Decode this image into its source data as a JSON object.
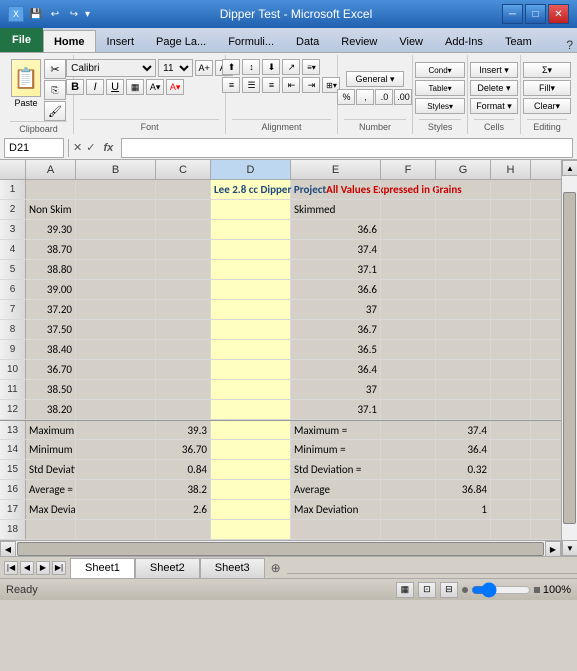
{
  "window": {
    "title": "Dipper Test - Microsoft Excel"
  },
  "tabs": [
    "File",
    "Home",
    "Insert",
    "Page Layout",
    "Formulas",
    "Data",
    "Review",
    "View",
    "Add-Ins",
    "Team"
  ],
  "nameBox": "D21",
  "ribbon": {
    "clipboard": "Clipboard",
    "font": "Font",
    "alignment": "Alignment",
    "number": "Number",
    "styles": "Styles",
    "cells": "Cells",
    "editing": "Editing"
  },
  "fontName": "Calibri",
  "fontSize": "11",
  "columns": [
    "A",
    "B",
    "C",
    "D",
    "E",
    "F",
    "G",
    "H"
  ],
  "rows": [
    {
      "num": 1,
      "cells": {
        "A": "",
        "B": "",
        "C": "",
        "D": "Lee 2.8 cc Dipper Project All Values Expressed in Grains",
        "E": "",
        "F": "",
        "G": "",
        "H": ""
      },
      "merged": true,
      "titleBlue": "Lee 2.8 cc Dipper Project ",
      "titleRed": "All Values Expressed in Grains"
    },
    {
      "num": 2,
      "cells": {
        "A": "Non Skim",
        "B": "",
        "C": "",
        "D": "",
        "E": "Skimmed",
        "F": "",
        "G": "",
        "H": ""
      }
    },
    {
      "num": 3,
      "cells": {
        "A": "39.30",
        "B": "",
        "C": "",
        "D": "",
        "E": "36.6",
        "F": "",
        "G": "",
        "H": ""
      }
    },
    {
      "num": 4,
      "cells": {
        "A": "38.70",
        "B": "",
        "C": "",
        "D": "",
        "E": "37.4",
        "F": "",
        "G": "",
        "H": ""
      }
    },
    {
      "num": 5,
      "cells": {
        "A": "38.80",
        "B": "",
        "C": "",
        "D": "",
        "E": "37.1",
        "F": "",
        "G": "",
        "H": ""
      }
    },
    {
      "num": 6,
      "cells": {
        "A": "39.00",
        "B": "",
        "C": "",
        "D": "",
        "E": "36.6",
        "F": "",
        "G": "",
        "H": ""
      }
    },
    {
      "num": 7,
      "cells": {
        "A": "37.20",
        "B": "",
        "C": "",
        "D": "",
        "E": "37",
        "F": "",
        "G": "",
        "H": ""
      }
    },
    {
      "num": 8,
      "cells": {
        "A": "37.50",
        "B": "",
        "C": "",
        "D": "",
        "E": "36.7",
        "F": "",
        "G": "",
        "H": ""
      }
    },
    {
      "num": 9,
      "cells": {
        "A": "38.40",
        "B": "",
        "C": "",
        "D": "",
        "E": "36.5",
        "F": "",
        "G": "",
        "H": ""
      }
    },
    {
      "num": 10,
      "cells": {
        "A": "36.70",
        "B": "",
        "C": "",
        "D": "",
        "E": "36.4",
        "F": "",
        "G": "",
        "H": ""
      }
    },
    {
      "num": 11,
      "cells": {
        "A": "38.50",
        "B": "",
        "C": "",
        "D": "",
        "E": "37",
        "F": "",
        "G": "",
        "H": ""
      }
    },
    {
      "num": 12,
      "cells": {
        "A": "38.20",
        "B": "",
        "C": "",
        "D": "",
        "E": "37.1",
        "F": "",
        "G": "",
        "H": ""
      }
    },
    {
      "num": 13,
      "cells": {
        "A": "Maximum =",
        "B": "",
        "C": "39.3",
        "D": "",
        "E": "Maximum =",
        "F": "",
        "G": "37.4",
        "H": ""
      }
    },
    {
      "num": 14,
      "cells": {
        "A": "Minimum =",
        "B": "",
        "C": "36.70",
        "D": "",
        "E": "Minimum =",
        "F": "",
        "G": "36.4",
        "H": ""
      }
    },
    {
      "num": 15,
      "cells": {
        "A": "Std Deviation  =",
        "B": "",
        "C": "0.84",
        "D": "",
        "E": "Std Deviation =",
        "F": "",
        "G": "0.32",
        "H": ""
      }
    },
    {
      "num": 16,
      "cells": {
        "A": "Average =",
        "B": "",
        "C": "38.2",
        "D": "",
        "E": "Average",
        "F": "",
        "G": "36.84",
        "H": ""
      }
    },
    {
      "num": 17,
      "cells": {
        "A": "Max Deviation =",
        "B": "",
        "C": "2.6",
        "D": "",
        "E": "Max Deviation",
        "F": "",
        "G": "1",
        "H": ""
      }
    },
    {
      "num": 18,
      "cells": {
        "A": "",
        "B": "",
        "C": "",
        "D": "",
        "E": "",
        "F": "",
        "G": "",
        "H": ""
      }
    }
  ],
  "sheets": [
    "Sheet1",
    "Sheet2",
    "Sheet3"
  ],
  "activeSheet": "Sheet1",
  "status": "Ready",
  "zoom": "100%"
}
